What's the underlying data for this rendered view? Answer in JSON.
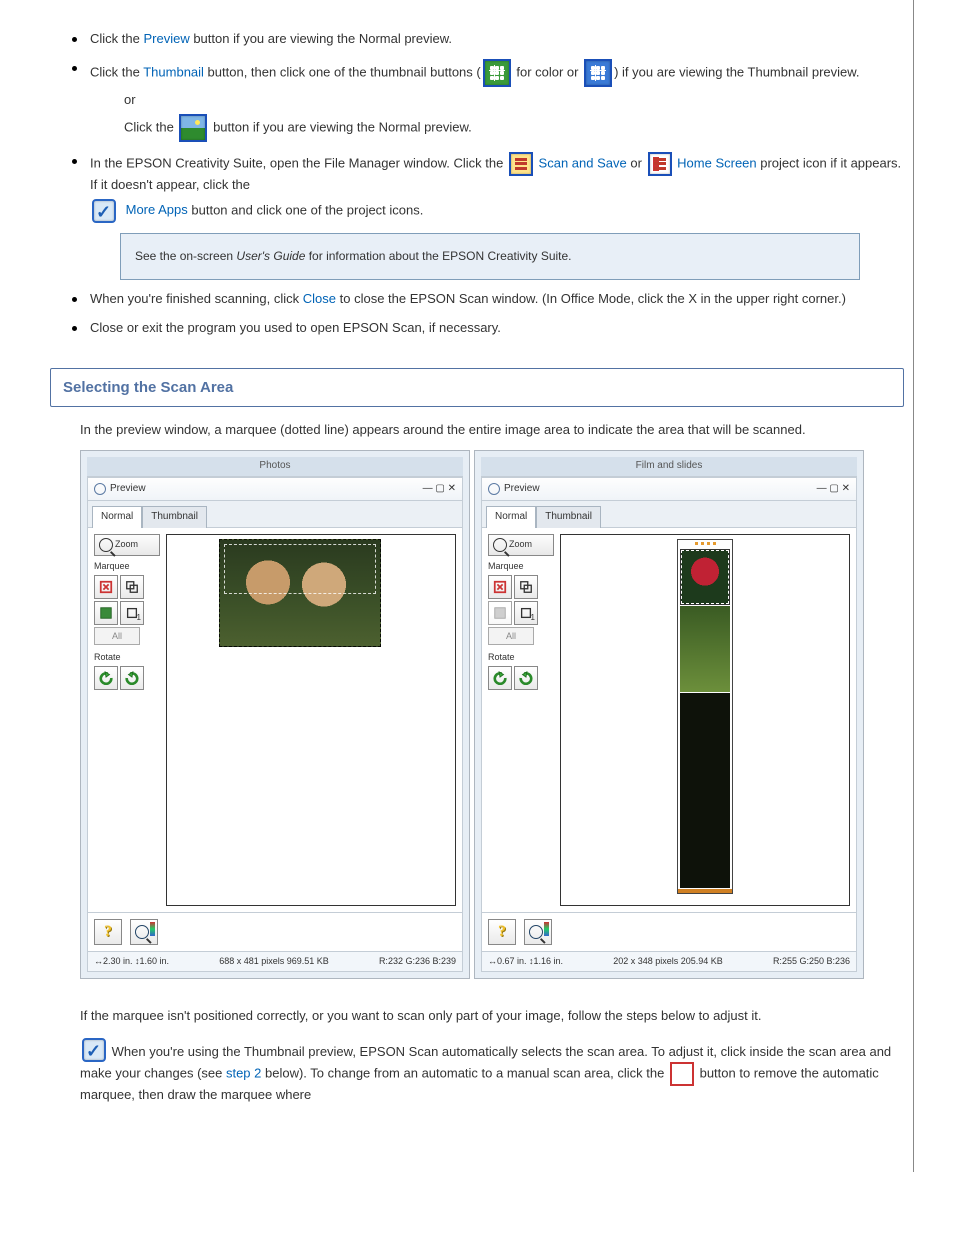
{
  "bullets": {
    "b1_pre": "Click the ",
    "b1_link": "Preview",
    "b1_post": " button if you are viewing the Normal preview.",
    "b2_pre": "Click the ",
    "b2_link": "Thumbnail",
    "b2_mid": " button, then click one of the thumbnail buttons (",
    "b2_mid2": " for color or ",
    "b2_post": ") if you are viewing the Thumbnail preview.",
    "b2_or": "or",
    "b2_sub_pre": "Click the ",
    "b2_sub_post": " button if you are viewing the Normal preview.",
    "b3_pre": "In the EPSON Creativity Suite, open the File Manager window. Click the ",
    "b3_link1": "Scan and Save",
    "b3_mid": " or ",
    "b3_link2": "Home Screen",
    "b3_post": " project icon if it appears. If it doesn't appear, click the",
    "b3_link3": "More Apps",
    "b3_post2": " button and click one of the project icons.",
    "note_pre": "See the on-screen ",
    "note_ital": "User's Guide",
    "note_post": " for information about the EPSON Creativity Suite.",
    "b4_pre": "When you're finished scanning, click ",
    "b4_link": "Close",
    "b4_post": " to close the EPSON Scan window. (In Office Mode, click the X in the upper right corner.)",
    "b5": "Close or exit the program you used to open EPSON Scan, if necessary."
  },
  "sectionTitle": "Selecting the Scan Area",
  "intro": "In the preview window, a marquee (dotted line) appears around the entire image area to indicate the area that will be scanned.",
  "caps": {
    "photos": "Photos",
    "film": "Film and slides"
  },
  "preview": {
    "title": "Preview",
    "tabs": {
      "normal": "Normal",
      "thumb": "Thumbnail"
    },
    "zoom": "Zoom",
    "marquee": "Marquee",
    "all": "All",
    "rotate": "Rotate",
    "num1": "1",
    "status_left_a": "↔2.30 in.  ↕1.60 in.",
    "status_mid_a": "688 x 481 pixels 969.51 KB",
    "status_right_a": "R:232 G:236 B:239",
    "status_left_b": "↔0.67 in.  ↕1.16 in.",
    "status_mid_b": "202 x 348 pixels 205.94 KB",
    "status_right_b": "R:255 G:250 B:236"
  },
  "para2": "If the marquee isn't positioned correctly, or you want to scan only part of your image, follow the steps below to adjust it.",
  "finalnote_pre": "When you're using the Thumbnail preview, EPSON Scan automatically selects the scan area. To adjust it, click inside the scan area and make your changes (see ",
  "finalnote_link": "step 2",
  "finalnote_mid": " below). To change from an automatic to a manual scan area, click the ",
  "finalnote_post": " button to remove the automatic marquee, then draw the marquee where"
}
